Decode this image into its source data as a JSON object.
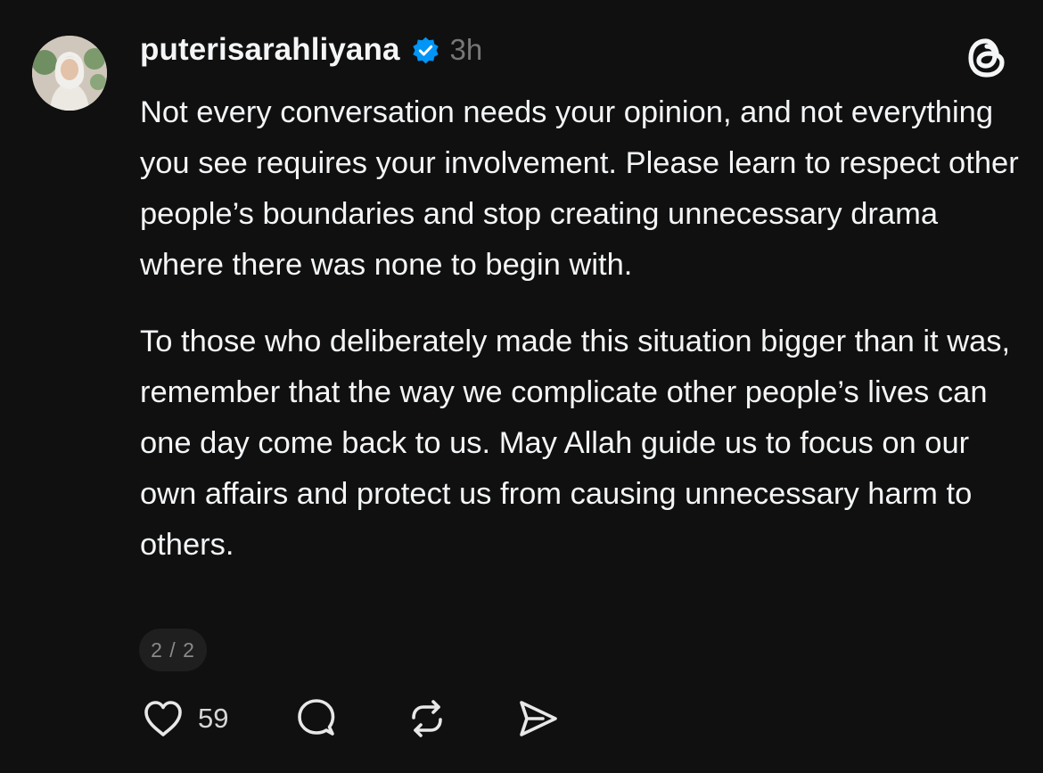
{
  "post": {
    "author": {
      "username": "puterisarahliyana",
      "verified": true,
      "time_ago": "3h",
      "avatar_icon": "profile-avatar"
    },
    "paragraphs": [
      "Not every conversation needs your opinion, and not everything you see requires your involvement. Please learn to respect other people’s boundaries and stop creating unnecessary drama where there was none to begin with.",
      "To those who deliberately made this situation bigger than it was, remember that the way we complicate other people’s lives can one day come back to us. May Allah guide us to focus on our own affairs and protect us from causing unnecessary harm to others."
    ],
    "page_indicator": "2 / 2",
    "actions": {
      "like_count": "59",
      "like_icon": "heart-icon",
      "reply_icon": "comment-icon",
      "repost_icon": "repost-icon",
      "share_icon": "send-icon"
    }
  },
  "app": {
    "logo_icon": "threads-logo-icon"
  },
  "colors": {
    "background": "#101010",
    "text": "#f3f5f7",
    "muted": "#777777",
    "verified_badge": "#0095f6",
    "badge_bg": "#1f1f1f"
  }
}
